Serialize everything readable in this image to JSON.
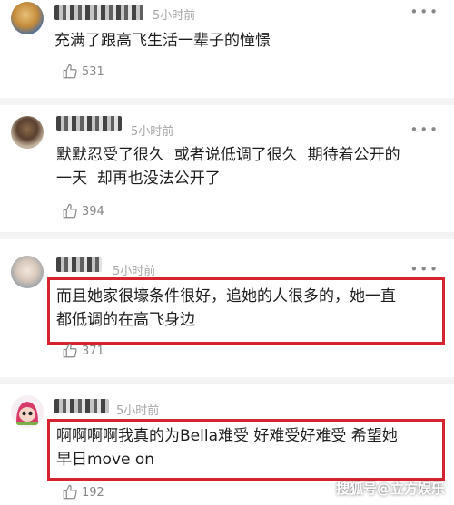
{
  "comments": [
    {
      "time": "5小时前",
      "text_lines": [
        "充满了跟高飞生活一辈子的憧憬"
      ],
      "likes": "531",
      "more": "•••"
    },
    {
      "time": "5小时前",
      "text_lines": [
        "默默忍受了很久  或者说低调了很久  期待着公开的",
        "一天  却再也没法公开了"
      ],
      "likes": "394",
      "more": "•••"
    },
    {
      "time": "5小时前",
      "text_lines": [
        "而且她家很壕条件很好，追她的人很多的，她一直",
        "都低调的在高飞身边"
      ],
      "likes": "371",
      "more": "•••"
    },
    {
      "time": "5小时前",
      "text_lines": [
        "啊啊啊啊我真的为Bella难受 好难受好难受 希望她",
        "早日move on"
      ],
      "likes": "192",
      "more": "•••"
    }
  ],
  "watermark": "搜狐号@立方娱乐",
  "colors": {
    "highlight": "#d5232f",
    "time": "#a6a6a6"
  }
}
